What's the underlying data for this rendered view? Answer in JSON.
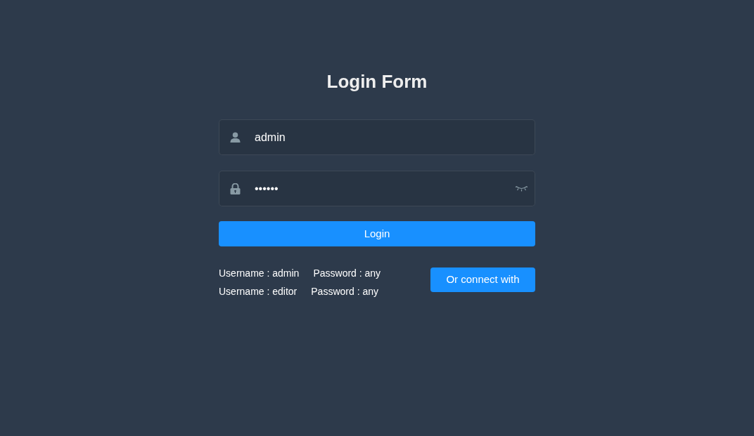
{
  "title": "Login Form",
  "fields": [
    {
      "kind": "username",
      "value": "admin"
    },
    {
      "kind": "password",
      "value": "••••••"
    }
  ],
  "login_button": "Login",
  "tips": [
    {
      "username": "Username : admin",
      "password": "Password : any"
    },
    {
      "username": "Username : editor",
      "password": "Password : any"
    }
  ],
  "connect_button": "Or connect with"
}
